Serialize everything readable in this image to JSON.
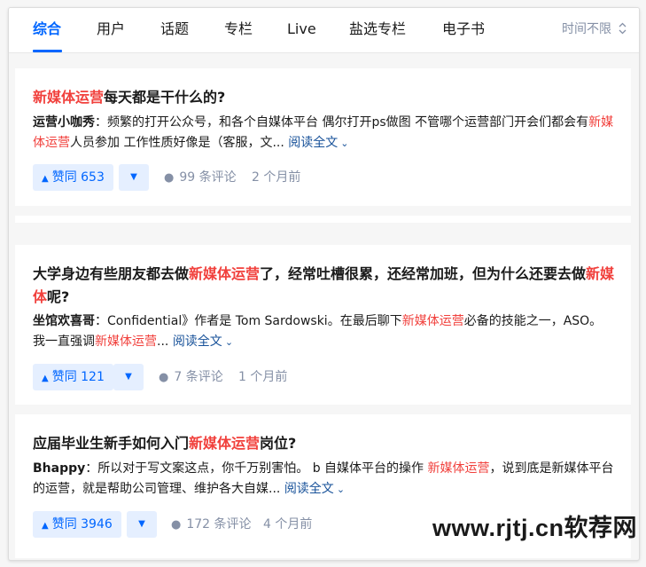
{
  "tabs": [
    {
      "label": "综合",
      "active": true
    },
    {
      "label": "用户"
    },
    {
      "label": "话题"
    },
    {
      "label": "专栏"
    },
    {
      "label": "Live"
    },
    {
      "label": "盐选专栏"
    },
    {
      "label": "电子书"
    }
  ],
  "sort": {
    "label": "时间不限",
    "icon": "chevron-updown-icon"
  },
  "highlight_color": "#f1403c",
  "accent_color": "#0066ff",
  "results": [
    {
      "title_hl": "新媒体运营",
      "title_rest": "每天都是干什么的?",
      "author": "运营小咖秀",
      "excerpt_a": "：频繁的打开公众号，和各个自媒体平台 偶尔打开ps做图 不管哪个运营部门开会们都会有",
      "excerpt_hl": "新媒体运营",
      "excerpt_b": "人员参加 工作性质好像是（客服，文...",
      "read_more": "阅读全文",
      "vote": "赞同 653",
      "comments": "99 条评论",
      "time": "2 个月前"
    },
    {
      "title_a": "大学身边有些朋友都去做",
      "title_hl": "新媒体运营",
      "title_b": "了，经常吐槽很累，还经常加班，但为什么还要去做",
      "title_hl2": "新媒体",
      "title_c": "呢?",
      "author": "坐馆欢喜哥",
      "excerpt_a": "：Confidential》作者是 Tom Sardowski。在最后聊下",
      "excerpt_hl": "新媒体运营",
      "excerpt_b": "必备的技能之一，ASO。 我一直强调",
      "excerpt_hl2": "新媒体运营",
      "excerpt_c": "...",
      "read_more": "阅读全文",
      "vote": "赞同 121",
      "comments": "7 条评论",
      "time": "1 个月前"
    },
    {
      "title_a": "应届毕业生新手如何入门",
      "title_hl": "新媒体运营",
      "title_b": "岗位?",
      "author": "Bhappy",
      "excerpt_a": "：所以对于写文案这点，你千万别害怕。 b 自媒体平台的操作 ",
      "excerpt_hl": "新媒体运营",
      "excerpt_b": "，说到底是新媒体平台的运营，就是帮助公司管理、维护各大自媒...",
      "read_more": "阅读全文",
      "vote": "赞同 3946",
      "comments": "172 条评论",
      "time": "4 个月前"
    }
  ],
  "watermark": "www.rjtj.cn软荐网"
}
